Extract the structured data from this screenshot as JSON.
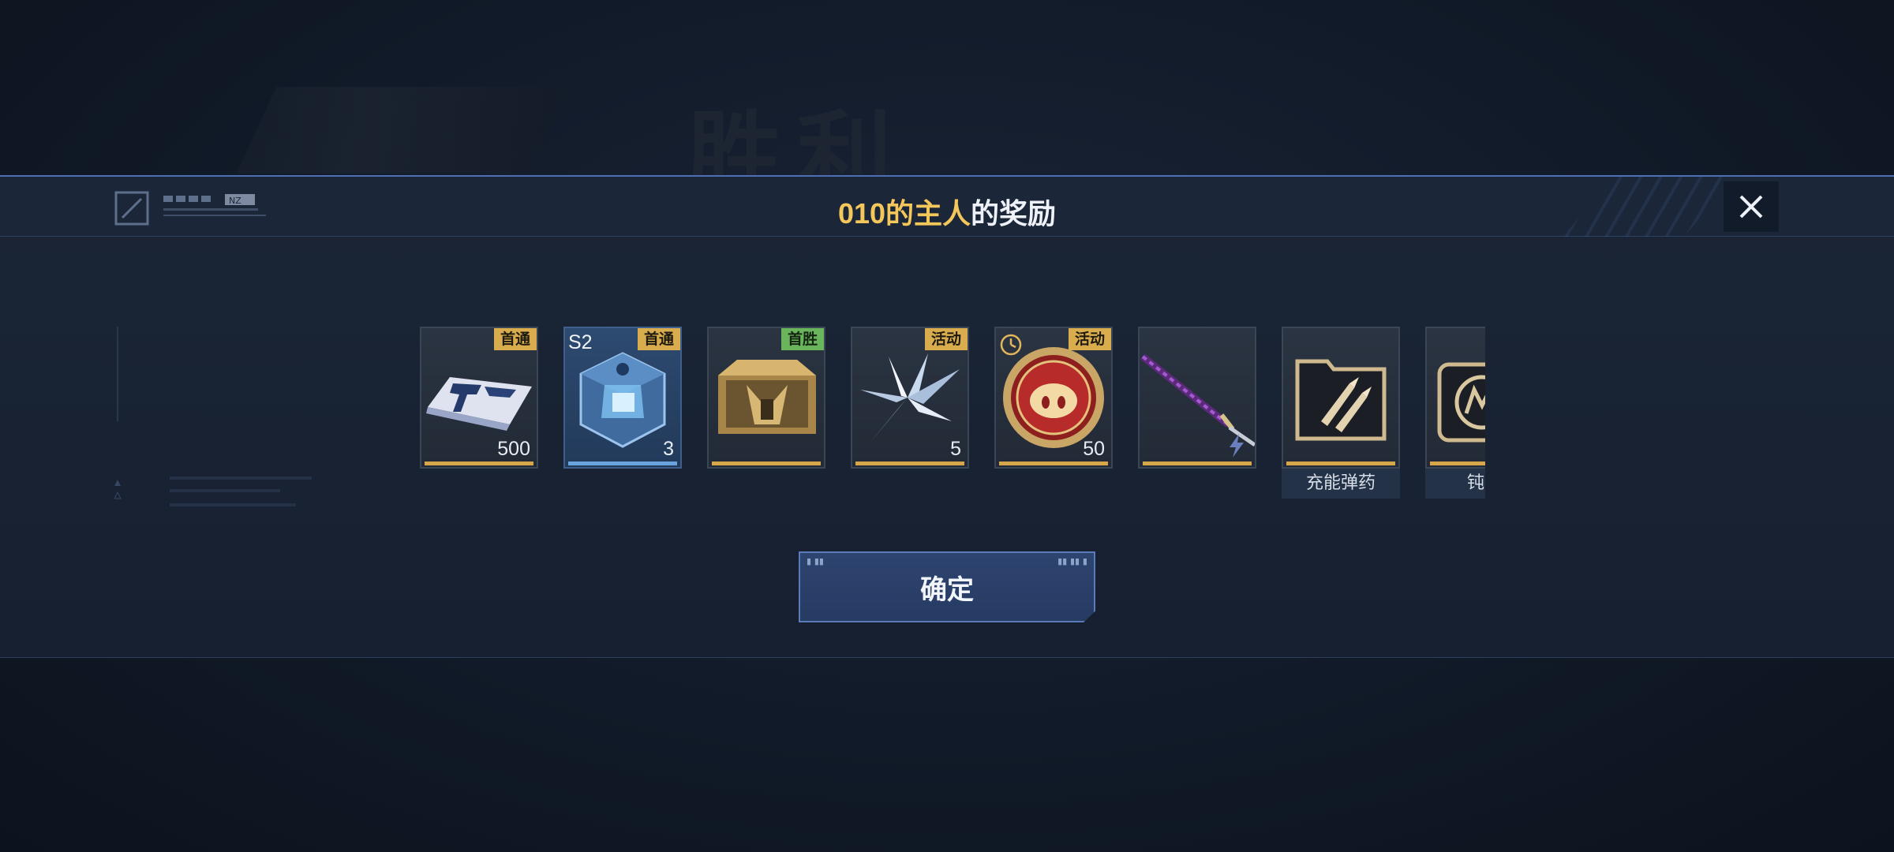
{
  "background": {
    "victory_text": "胜利"
  },
  "header": {
    "title_highlight": "010的主人",
    "title_rest": "的奖励",
    "close_icon": "close-icon",
    "deco_badge": "NZ"
  },
  "rewards": [
    {
      "icon": "ticket-card-icon",
      "tag": "首通",
      "tag_color": "#d9ac4e",
      "count": "500",
      "season": "",
      "name": "",
      "rarity": "gold"
    },
    {
      "icon": "blue-crystal-cube-icon",
      "tag": "首通",
      "tag_color": "#d9ac4e",
      "count": "3",
      "season": "S2",
      "name": "",
      "rarity": "blue"
    },
    {
      "icon": "gold-chest-icon",
      "tag": "首胜",
      "tag_color": "#6ab55c",
      "count": "",
      "season": "",
      "name": "",
      "rarity": "gold"
    },
    {
      "icon": "silver-shard-icon",
      "tag": "活动",
      "tag_color": "#d9ac4e",
      "count": "5",
      "season": "",
      "name": "",
      "rarity": "gold"
    },
    {
      "icon": "pig-coin-icon",
      "tag": "活动",
      "tag_color": "#d9ac4e",
      "count": "50",
      "season": "",
      "name": "",
      "rarity": "gold",
      "timed": true
    },
    {
      "icon": "katana-icon",
      "tag": "",
      "count": "",
      "season": "",
      "name": "",
      "rarity": "gold",
      "bolt": true
    },
    {
      "icon": "charged-ammo-icon",
      "tag": "",
      "count": "",
      "season": "",
      "name": "充能弹药",
      "rarity": "gold"
    },
    {
      "icon": "emblem-icon",
      "tag": "",
      "count": "",
      "season": "",
      "name": "钝化",
      "rarity": "gold"
    }
  ],
  "confirm_button": {
    "label": "确定"
  },
  "colors": {
    "accent_gold": "#f3c75a",
    "panel_border": "#4f6fb5",
    "tag_gold": "#d9ac4e",
    "tag_green": "#6ab55c"
  }
}
